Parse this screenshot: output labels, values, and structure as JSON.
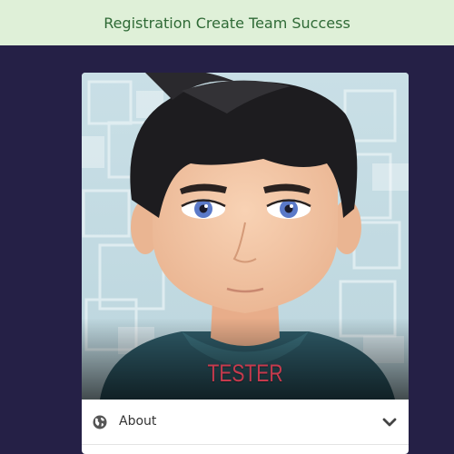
{
  "alert": {
    "message": "Registration Create Team Success",
    "background": "#dff0d8",
    "text_color": "#2f6a36"
  },
  "page": {
    "background": "#252046"
  },
  "profile": {
    "name": "TESTER",
    "name_color": "#c63a4d",
    "sections": [
      {
        "label": "About",
        "icon": "globe-icon",
        "toggle_icon": "chevron-down-icon"
      }
    ]
  }
}
